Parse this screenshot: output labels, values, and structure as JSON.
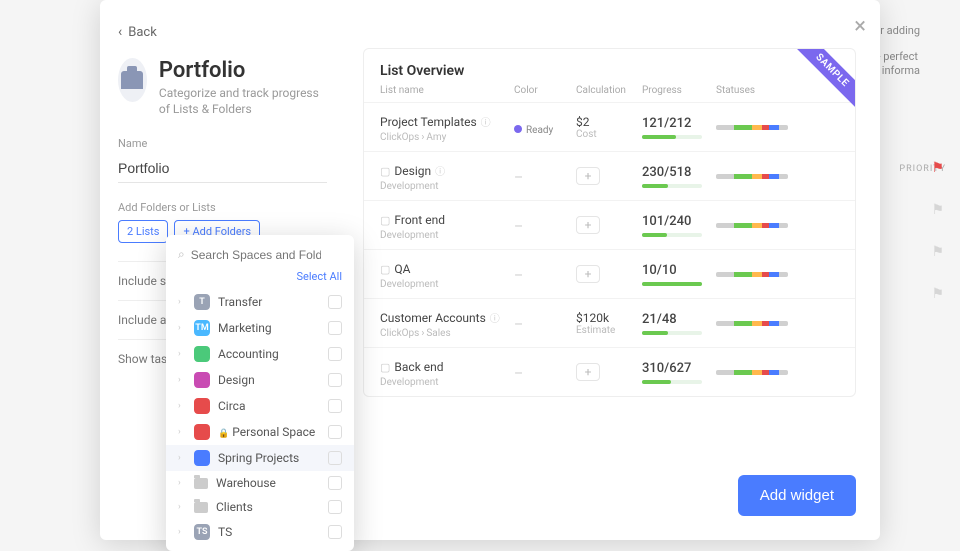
{
  "nav": {
    "back": "Back"
  },
  "title": "Portfolio",
  "subtitle": "Categorize and track progress of Lists & Folders",
  "name_field": {
    "label": "Name",
    "value": "Portfolio"
  },
  "add_section": {
    "label": "Add Folders or Lists",
    "pill1": "2 Lists",
    "pill2": "+ Add Folders"
  },
  "config_lines": {
    "include_subtask": "Include subtask",
    "include_archived": "Include archived",
    "show_tasks": "Show tasks completed more than"
  },
  "dropdown": {
    "search_placeholder": "Search Spaces and Folders",
    "select_all": "Select All",
    "items": [
      {
        "label": "Transfer",
        "bg": "#9aa3b5",
        "initial": "T",
        "type": "space"
      },
      {
        "label": "Marketing",
        "bg": "#4ab8ff",
        "initial": "TM",
        "type": "space"
      },
      {
        "label": "Accounting",
        "bg": "#4bc97a",
        "initial": "",
        "type": "space",
        "icon": "list"
      },
      {
        "label": "Design",
        "bg": "#c94bb3",
        "initial": "",
        "type": "space",
        "icon": "pen"
      },
      {
        "label": "Circa",
        "bg": "#e64b4b",
        "initial": "",
        "type": "space",
        "icon": "dot"
      },
      {
        "label": "Personal Space",
        "bg": "#e64b4b",
        "initial": "",
        "type": "space",
        "locked": true
      },
      {
        "label": "Spring Projects",
        "bg": "#4a7cff",
        "initial": "",
        "type": "space",
        "icon": "check",
        "hover": true
      },
      {
        "label": "Warehouse",
        "type": "folder"
      },
      {
        "label": "Clients",
        "type": "folder"
      },
      {
        "label": "TS",
        "bg": "#9aa3b5",
        "initial": "TS",
        "type": "space"
      }
    ]
  },
  "preview": {
    "title": "List Overview",
    "sample": "SAMPLE",
    "headers": {
      "name": "List name",
      "color": "Color",
      "calc": "Calculation",
      "progress": "Progress",
      "status": "Statuses"
    },
    "rows": [
      {
        "name": "Project Templates",
        "sub": "ClickOps",
        "sub2": "Amy",
        "info": true,
        "color_label": "Ready",
        "calc": "$2",
        "calc_sub": "Cost",
        "progress": "121/212",
        "pct": 57
      },
      {
        "name": "Design",
        "sub": "Development",
        "folder": true,
        "info": true,
        "progress": "230/518",
        "pct": 44
      },
      {
        "name": "Front end",
        "sub": "Development",
        "folder": true,
        "progress": "101/240",
        "pct": 42
      },
      {
        "name": "QA",
        "sub": "Development",
        "folder": true,
        "progress": "10/10",
        "pct": 100
      },
      {
        "name": "Customer Accounts",
        "sub": "ClickOps",
        "sub2": "Sales",
        "info": true,
        "calc": "$120k",
        "calc_sub": "Estimate",
        "progress": "21/48",
        "pct": 44
      },
      {
        "name": "Back end",
        "sub": "Development",
        "folder": true,
        "progress": "310/627",
        "pct": 49
      }
    ]
  },
  "add_widget": "Add widget",
  "bg_fragments": {
    "priority": "PRIORITY"
  }
}
